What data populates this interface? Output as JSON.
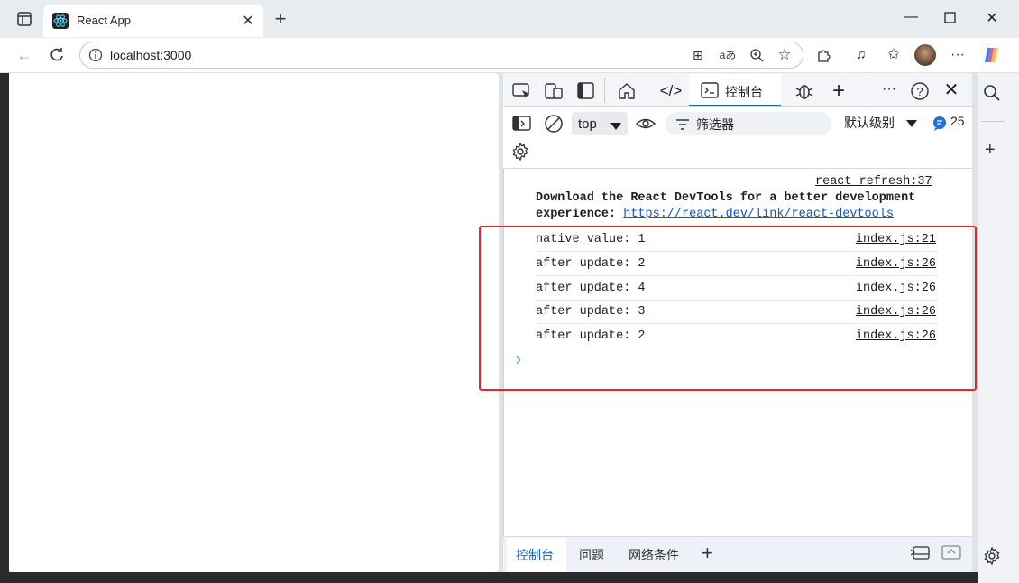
{
  "browser": {
    "tab_title": "React App",
    "address": "localhost:3000"
  },
  "devtools": {
    "console_tab_label": "控制台",
    "context_select": "top",
    "filter_placeholder": "筛选器",
    "levels_label": "默认级别",
    "message_count": "25",
    "react_notice": {
      "source": "react refresh:37",
      "line1": "Download the React DevTools for a better development",
      "line2_prefix": "experience: ",
      "link": "https://react.dev/link/react-devtools"
    },
    "log_lines": [
      {
        "message": "native value: 1",
        "source": "index.js:21"
      },
      {
        "message": "after update: 2",
        "source": "index.js:26"
      },
      {
        "message": "after update: 4",
        "source": "index.js:26"
      },
      {
        "message": "after update: 3",
        "source": "index.js:26"
      },
      {
        "message": "after update: 2",
        "source": "index.js:26"
      }
    ],
    "prompt_symbol": "›",
    "drawer_tabs": [
      "控制台",
      "问题",
      "网络条件"
    ]
  },
  "colors": {
    "accent": "#0b63c4",
    "highlight_box": "#e3262b"
  }
}
